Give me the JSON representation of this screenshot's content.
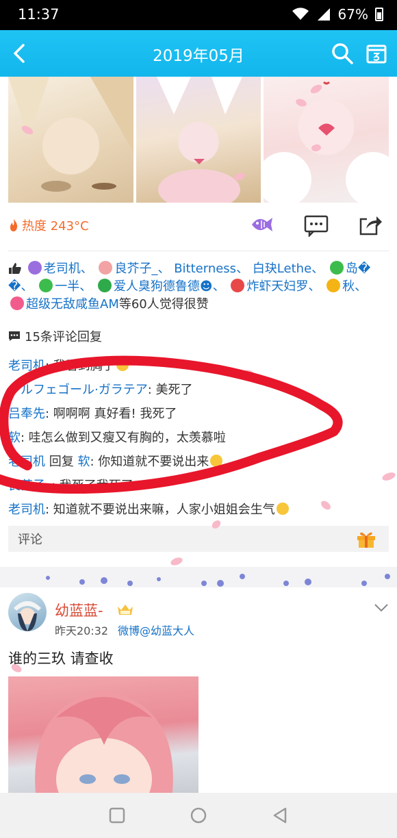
{
  "status_bar": {
    "time": "11:37",
    "battery": "67%"
  },
  "header": {
    "title": "2019年05月"
  },
  "post1": {
    "heat_label": "热度 243°C",
    "likes_segments": [
      {
        "kind": "name",
        "text": "老司机、"
      },
      {
        "kind": "name",
        "text": "良芥子_、"
      },
      {
        "kind": "name",
        "text": "Bitterness、"
      },
      {
        "kind": "name",
        "text": "白玦Lethe、"
      },
      {
        "kind": "name",
        "text": "岛�"
      },
      {
        "kind": "name",
        "text": "�、"
      },
      {
        "kind": "name",
        "text": "一半、"
      },
      {
        "kind": "name",
        "text": "爱人臭狗德鲁德☻、"
      },
      {
        "kind": "name",
        "text": "炸虾天妇罗、"
      },
      {
        "kind": "name",
        "text": "秋、"
      },
      {
        "kind": "name",
        "text": "超级无敌咸鱼AM"
      },
      {
        "kind": "plain",
        "text": "等60人觉得很赞"
      }
    ],
    "comment_count": "15条评论回复",
    "comments": [
      {
        "name": "老司机",
        "text": ": 我看到胸了"
      },
      {
        "name": "ナルフェゴール·ガラテア",
        "text": ": 美死了"
      },
      {
        "name": "吕奉先",
        "text": ": 啊啊啊 真好看! 我死了"
      },
      {
        "name": "软",
        "text": ": 哇怎么做到又瘦又有胸的，太羡慕啦"
      },
      {
        "name": "老司机",
        "reply_word": " 回复 ",
        "reply_to": "软",
        "text": ": 你知道就不要说出来"
      },
      {
        "name": "良芥子_",
        "text": ": 我死了我死了"
      },
      {
        "name": "老司机",
        "text": ": 知道就不要说出来嘛，人家小姐姐会生气"
      }
    ],
    "comment_input_placeholder": "评论"
  },
  "post2": {
    "user_name": "幼蓝蓝-",
    "time": "昨天20:32",
    "source": "微博@幼蓝大人",
    "text": "谁的三玖 请查收"
  },
  "colors": {
    "header": "#13b6ec",
    "link": "#1672c8",
    "heat": "#f46b2b",
    "username": "#d94b36",
    "scribble": "#e8162b"
  }
}
